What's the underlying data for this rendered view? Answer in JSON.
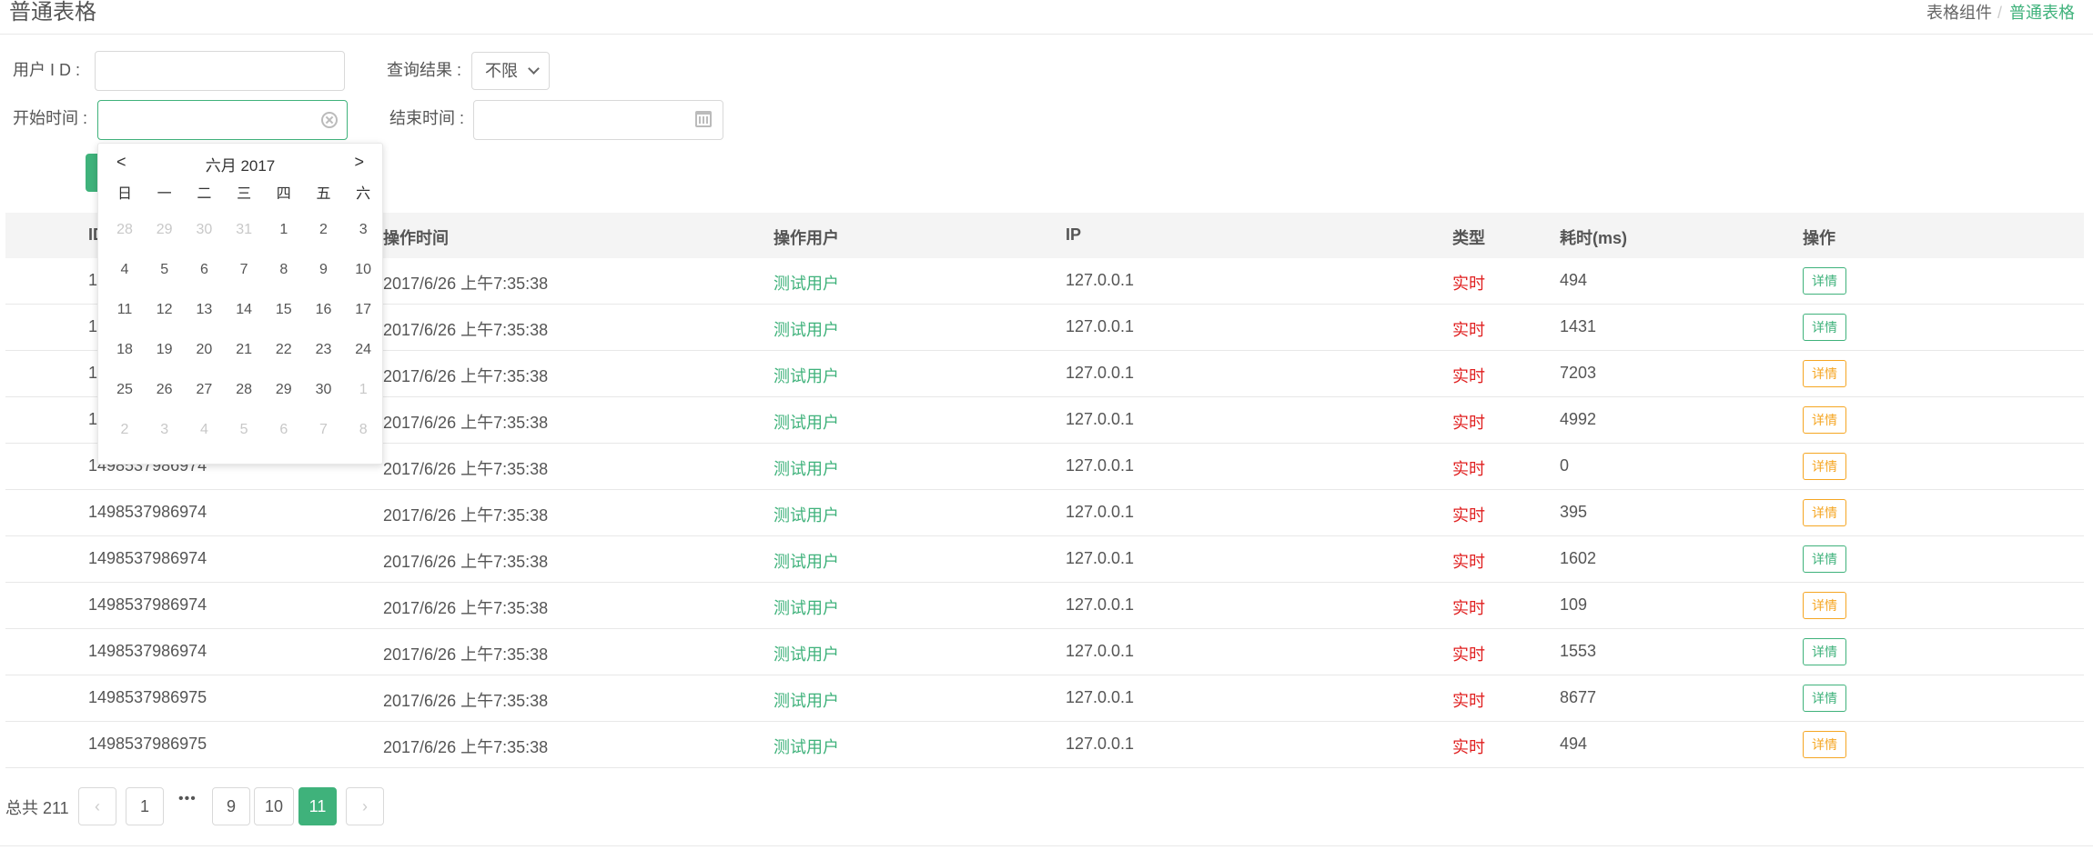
{
  "header": {
    "title": "普通表格",
    "breadcrumb": {
      "parent": "表格组件",
      "separator": "/",
      "current": "普通表格"
    }
  },
  "filters": {
    "user_id_label": "用户 I D :",
    "user_id_value": "",
    "query_result_label": "查询结果 :",
    "query_result_selected": "不限",
    "start_time_label": "开始时间 :",
    "start_time_value": "",
    "end_time_label": "结束时间 :",
    "end_time_value": ""
  },
  "datepicker": {
    "title": "六月 2017",
    "prev": "<",
    "next": ">",
    "weekdays": [
      "日",
      "一",
      "二",
      "三",
      "四",
      "五",
      "六"
    ],
    "days": [
      [
        "28",
        "29",
        "30",
        "31",
        "1",
        "2",
        "3"
      ],
      [
        "4",
        "5",
        "6",
        "7",
        "8",
        "9",
        "10"
      ],
      [
        "11",
        "12",
        "13",
        "14",
        "15",
        "16",
        "17"
      ],
      [
        "18",
        "19",
        "20",
        "21",
        "22",
        "23",
        "24"
      ],
      [
        "25",
        "26",
        "27",
        "28",
        "29",
        "30",
        "1"
      ],
      [
        "2",
        "3",
        "4",
        "5",
        "6",
        "7",
        "8"
      ]
    ]
  },
  "table": {
    "columns": [
      "ID",
      "操作时间",
      "操作用户",
      "IP",
      "类型",
      "耗时(ms)",
      "操作"
    ],
    "detail_label": "详情",
    "rows": [
      {
        "id": "1",
        "time": "2017/6/26 上午7:35:38",
        "user": "测试用户",
        "ip": "127.0.0.1",
        "type": "实时",
        "cost": "494",
        "btn": "green"
      },
      {
        "id": "1",
        "time": "2017/6/26 上午7:35:38",
        "user": "测试用户",
        "ip": "127.0.0.1",
        "type": "实时",
        "cost": "1431",
        "btn": "green"
      },
      {
        "id": "1",
        "time": "2017/6/26 上午7:35:38",
        "user": "测试用户",
        "ip": "127.0.0.1",
        "type": "实时",
        "cost": "7203",
        "btn": "orange"
      },
      {
        "id": "1",
        "time": "2017/6/26 上午7:35:38",
        "user": "测试用户",
        "ip": "127.0.0.1",
        "type": "实时",
        "cost": "4992",
        "btn": "orange"
      },
      {
        "id": "1498537986974",
        "time": "2017/6/26 上午7:35:38",
        "user": "测试用户",
        "ip": "127.0.0.1",
        "type": "实时",
        "cost": "0",
        "btn": "orange"
      },
      {
        "id": "1498537986974",
        "time": "2017/6/26 上午7:35:38",
        "user": "测试用户",
        "ip": "127.0.0.1",
        "type": "实时",
        "cost": "395",
        "btn": "orange"
      },
      {
        "id": "1498537986974",
        "time": "2017/6/26 上午7:35:38",
        "user": "测试用户",
        "ip": "127.0.0.1",
        "type": "实时",
        "cost": "1602",
        "btn": "green"
      },
      {
        "id": "1498537986974",
        "time": "2017/6/26 上午7:35:38",
        "user": "测试用户",
        "ip": "127.0.0.1",
        "type": "实时",
        "cost": "109",
        "btn": "orange"
      },
      {
        "id": "1498537986974",
        "time": "2017/6/26 上午7:35:38",
        "user": "测试用户",
        "ip": "127.0.0.1",
        "type": "实时",
        "cost": "1553",
        "btn": "green"
      },
      {
        "id": "1498537986975",
        "time": "2017/6/26 上午7:35:38",
        "user": "测试用户",
        "ip": "127.0.0.1",
        "type": "实时",
        "cost": "8677",
        "btn": "green"
      },
      {
        "id": "1498537986975",
        "time": "2017/6/26 上午7:35:38",
        "user": "测试用户",
        "ip": "127.0.0.1",
        "type": "实时",
        "cost": "494",
        "btn": "orange"
      }
    ]
  },
  "pagination": {
    "total": "总共 211",
    "prev": "‹",
    "pages": [
      "1",
      "9",
      "10",
      "11"
    ],
    "ellipsis": "•••",
    "current": "11",
    "next": "›"
  },
  "colors": {
    "accent_green": "#3fb27b",
    "type_red": "#e02020",
    "detail_orange": "#f5a623"
  }
}
